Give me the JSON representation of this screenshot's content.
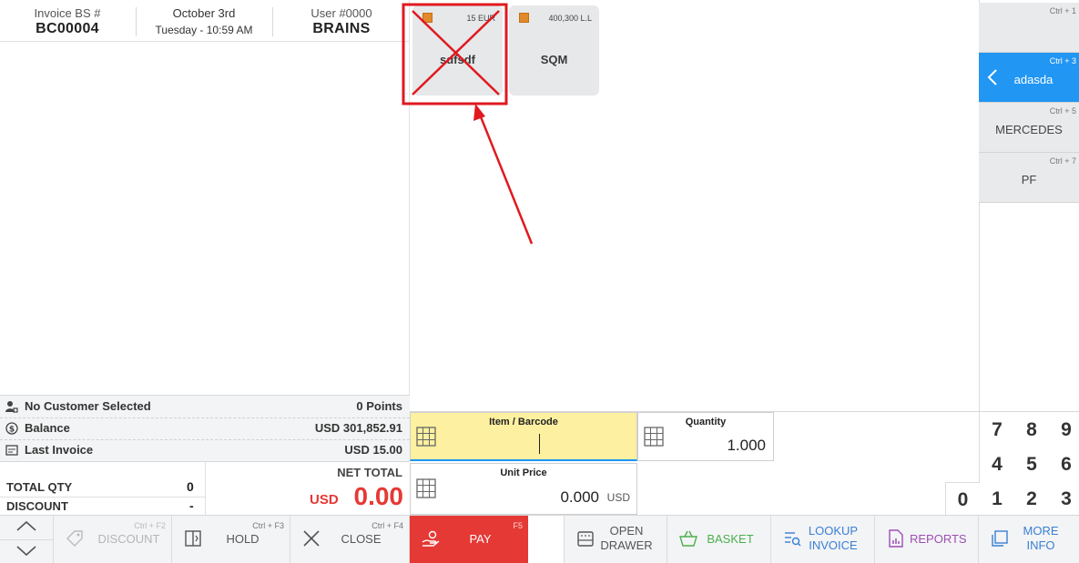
{
  "header": {
    "invoice_label": "Invoice BS #",
    "invoice_number": "BC00004",
    "date": "October 3rd",
    "datetime": "Tuesday - 10:59 AM",
    "user_label": "User #0000",
    "user_name": "BRAINS"
  },
  "customer": {
    "label": "No Customer Selected",
    "points_value": "0",
    "points_label": "Points",
    "balance_label": "Balance",
    "balance_value": "USD 301,852.91",
    "last_invoice_label": "Last Invoice",
    "last_invoice_value": "USD 15.00"
  },
  "totals": {
    "total_qty_label": "TOTAL QTY",
    "total_qty_value": "0",
    "discount_label": "DISCOUNT",
    "discount_value": "-",
    "net_total_label": "NET TOTAL",
    "currency": "USD",
    "net_total_value": "0.00"
  },
  "products": [
    {
      "name": "sdfsdf",
      "price": "15 EUR",
      "crossed_out": true
    },
    {
      "name": "SQM",
      "price": "400,300 L.L"
    }
  ],
  "categories": [
    {
      "name": "",
      "shortcut": "Ctrl + 1"
    },
    {
      "name": "adasda",
      "shortcut": "Ctrl + 3",
      "selected": true
    },
    {
      "name": "MERCEDES",
      "shortcut": "Ctrl + 5"
    },
    {
      "name": "PF",
      "shortcut": "Ctrl + 7"
    }
  ],
  "inputs": {
    "barcode_label": "Item / Barcode",
    "quantity_label": "Quantity",
    "quantity_value": "1.000",
    "unit_price_label": "Unit Price",
    "unit_price_value": "0.000",
    "unit_price_currency": "USD"
  },
  "numpad": {
    "k7": "7",
    "k8": "8",
    "k9": "9",
    "k4": "4",
    "k5": "5",
    "k6": "6",
    "k0": "0",
    "k1": "1",
    "k2": "2",
    "k3": "3"
  },
  "toolbar": {
    "discount_label": "DISCOUNT",
    "discount_shortcut": "Ctrl + F2",
    "hold_label": "HOLD",
    "hold_shortcut": "Ctrl + F3",
    "close_label": "CLOSE",
    "close_shortcut": "Ctrl + F4",
    "pay_label": "PAY",
    "pay_shortcut": "F5",
    "open_drawer_line1": "OPEN",
    "open_drawer_line2": "DRAWER",
    "basket_label": "BASKET",
    "lookup_line1": "LOOKUP",
    "lookup_line2": "INVOICE",
    "reports_label": "REPORTS",
    "more_line1": "MORE",
    "more_line2": "INFO"
  },
  "colors": {
    "accent": "#2196f3",
    "pay": "#e53935",
    "barcode_bg": "#fdf0a0",
    "annotation": "#e0191f"
  }
}
